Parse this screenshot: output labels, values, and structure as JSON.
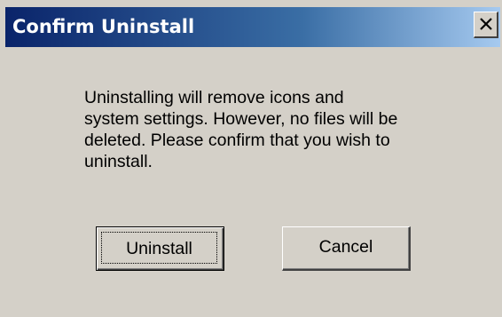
{
  "window": {
    "title": "Confirm Uninstall",
    "close_icon": "close-icon"
  },
  "message": {
    "line1": "Uninstalling will remove icons and",
    "line2": "system settings. However, no files will be",
    "line3": "deleted. Please confirm that you wish to",
    "line4": "uninstall."
  },
  "buttons": {
    "uninstall_label": "Uninstall",
    "cancel_label": "Cancel"
  },
  "colors": {
    "titlebar_start": "#0a246a",
    "titlebar_end": "#a6caf0",
    "dialog_face": "#d4d0c8"
  }
}
